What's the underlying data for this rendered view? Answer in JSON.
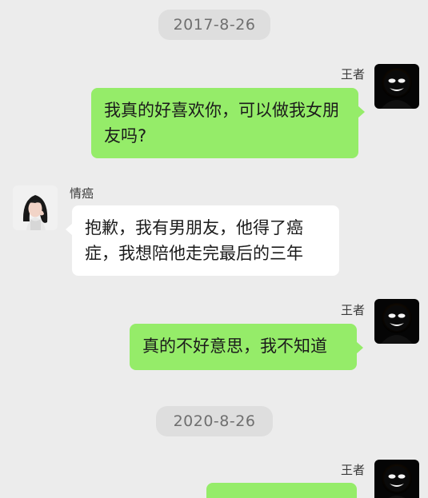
{
  "timestamps": [
    "2017-8-26",
    "2020-8-26"
  ],
  "contacts": {
    "me": "王者",
    "other": "情癌"
  },
  "messages": [
    {
      "sender": "王者",
      "text": "我真的好喜欢你，可以做我女朋友吗?"
    },
    {
      "sender": "情癌",
      "text": "抱歉，我有男朋友，他得了癌症，我想陪他走完最后的三年"
    },
    {
      "sender": "王者",
      "text": "真的不好意思，我不知道"
    },
    {
      "sender": "王者",
      "text": ""
    }
  ],
  "colors": {
    "background": "#ececec",
    "timestamp_bg": "#dedede",
    "timestamp_text": "#6f6f6f",
    "outgoing_bubble": "#95ec69",
    "incoming_bubble": "#ffffff"
  },
  "icons": {
    "me_avatar": "dark-masked-face-avatar-icon",
    "other_avatar": "woman-portrait-avatar-icon"
  }
}
